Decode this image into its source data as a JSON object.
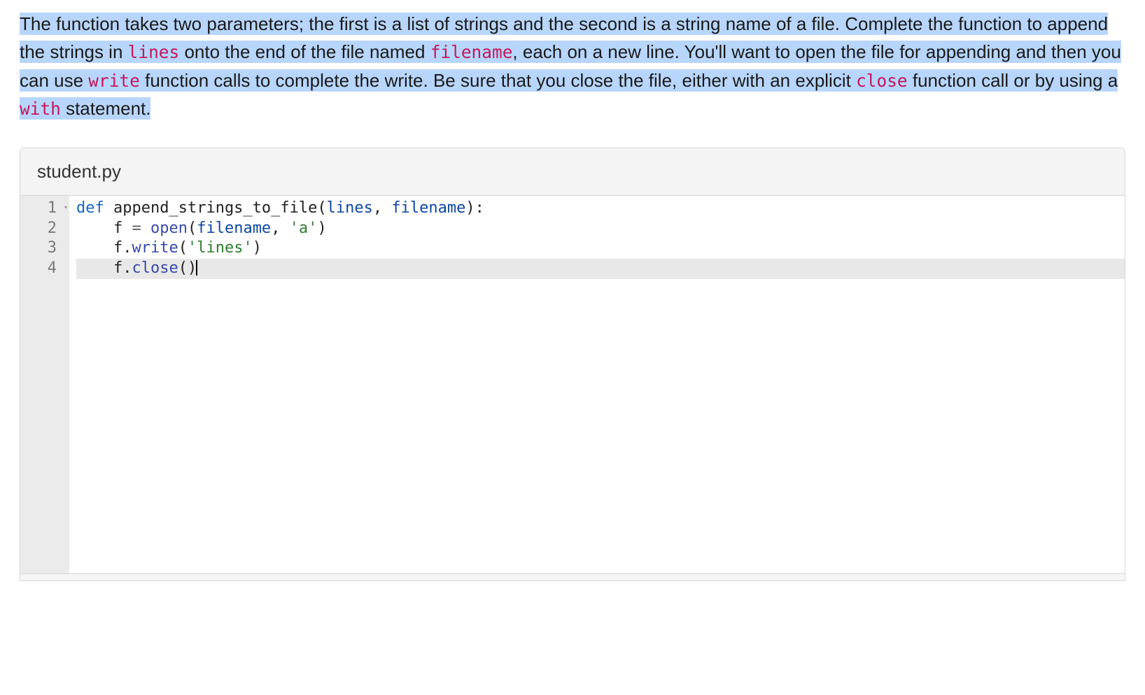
{
  "instructions": {
    "seg1": "The function takes two parameters; the first is a list of strings and the second is a string name of a file. Complete the function to append the strings in ",
    "kw1": "lines",
    "seg2": " onto the end of the file named ",
    "kw2": "filename",
    "seg3": ", each on a new line. You'll want to open the file for appending and then you can use ",
    "kw3": "write",
    "seg4": " function calls to complete the write. Be sure that you close the file, either with an explicit ",
    "kw4": "close",
    "seg5": " function call or by using a ",
    "kw5": "with",
    "seg6_highlighted": " statement.",
    "seg7_plain": ""
  },
  "editor": {
    "filename": "student.py",
    "gutter": [
      "1",
      "2",
      "3",
      "4"
    ],
    "fold_line": 0,
    "active_line": 3,
    "code": {
      "line1": {
        "def": "def",
        "sp1": " ",
        "fn": "append_strings_to_file",
        "open": "(",
        "p1": "lines",
        "comma": ", ",
        "p2": "filename",
        "close": "):"
      },
      "line2": {
        "indent": "    ",
        "lhs": "f",
        "sp": " ",
        "eq": "=",
        "sp2": " ",
        "call": "open",
        "open": "(",
        "arg1": "filename",
        "comma": ", ",
        "str": "'a'",
        "close": ")"
      },
      "line3": {
        "indent": "    ",
        "obj": "f",
        "dot": ".",
        "call": "write",
        "open": "(",
        "str": "'lines'",
        "close": ")"
      },
      "line4": {
        "indent": "    ",
        "obj": "f",
        "dot": ".",
        "call": "close",
        "open": "(",
        "close": ")"
      }
    }
  }
}
